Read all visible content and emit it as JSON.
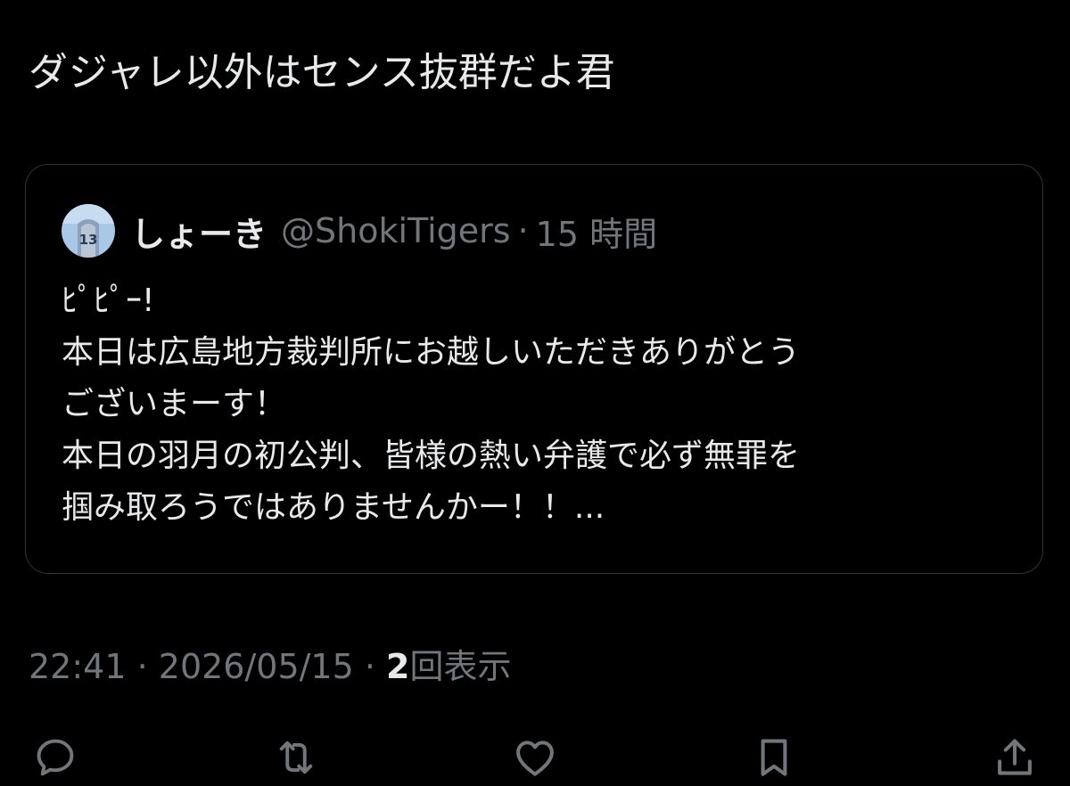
{
  "tweet": {
    "text": "ダジャレ以外はセンス抜群だよ君"
  },
  "quote": {
    "name": "しょーき",
    "handle": "@ShokiTigers",
    "separator": "·",
    "time": "15 時間",
    "avatar": {
      "icon": "avatar-jersey-13",
      "number": "13",
      "bg_color": "#9fc3e6"
    },
    "body_lines": [
      "ﾋﾟﾋﾟｰ!",
      "本日は広島地方裁判所にお越しいただきありがとう",
      "ございまーす！",
      "本日の羽月の初公判、皆様の熱い弁護で必ず無罪を",
      "掴み取ろうではありませんかー！！..."
    ]
  },
  "meta": {
    "time": "22:41",
    "sep1": " · ",
    "date": "2026/05/15",
    "sep2": " · ",
    "views_count": "2",
    "views_label": "回表示"
  },
  "actions": [
    {
      "name": "reply",
      "icon": "comment-icon"
    },
    {
      "name": "retweet",
      "icon": "retweet-icon"
    },
    {
      "name": "like",
      "icon": "heart-icon"
    },
    {
      "name": "bookmark",
      "icon": "bookmark-icon"
    },
    {
      "name": "share",
      "icon": "share-icon"
    }
  ],
  "colors": {
    "background": "#000000",
    "text_primary": "#e7e9ea",
    "text_secondary": "#71767b",
    "border": "#2f3336"
  }
}
